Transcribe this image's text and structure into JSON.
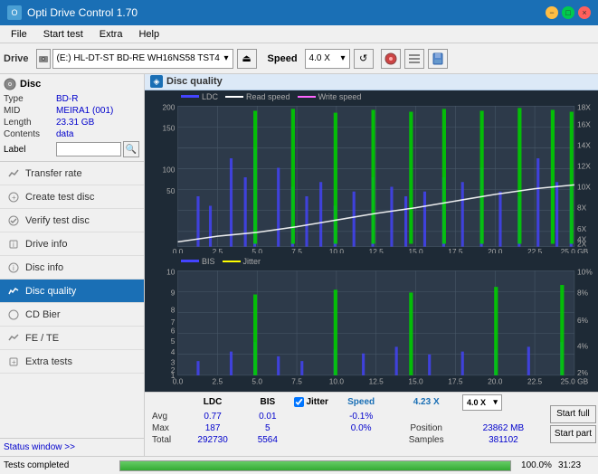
{
  "app": {
    "title": "Opti Drive Control 1.70",
    "icon": "O"
  },
  "titlebar": {
    "minimize": "−",
    "maximize": "□",
    "close": "×"
  },
  "menubar": {
    "items": [
      "File",
      "Start test",
      "Extra",
      "Help"
    ]
  },
  "toolbar": {
    "drive_label": "Drive",
    "drive_value": "(E:)  HL-DT-ST BD-RE  WH16NS58 TST4",
    "speed_label": "Speed",
    "speed_value": "4.0 X"
  },
  "disc": {
    "header": "Disc",
    "type_label": "Type",
    "type_value": "BD-R",
    "mid_label": "MID",
    "mid_value": "MEIRA1 (001)",
    "length_label": "Length",
    "length_value": "23.31 GB",
    "contents_label": "Contents",
    "contents_value": "data",
    "label_label": "Label",
    "label_value": ""
  },
  "sidebar": {
    "items": [
      {
        "id": "transfer-rate",
        "label": "Transfer rate",
        "active": false
      },
      {
        "id": "create-test-disc",
        "label": "Create test disc",
        "active": false
      },
      {
        "id": "verify-test-disc",
        "label": "Verify test disc",
        "active": false
      },
      {
        "id": "drive-info",
        "label": "Drive info",
        "active": false
      },
      {
        "id": "disc-info",
        "label": "Disc info",
        "active": false
      },
      {
        "id": "disc-quality",
        "label": "Disc quality",
        "active": true
      },
      {
        "id": "cd-bier",
        "label": "CD Bier",
        "active": false
      },
      {
        "id": "fe-te",
        "label": "FE / TE",
        "active": false
      },
      {
        "id": "extra-tests",
        "label": "Extra tests",
        "active": false
      }
    ]
  },
  "status_window": {
    "label": "Status window >>"
  },
  "panel": {
    "title": "Disc quality"
  },
  "chart_top": {
    "legend": [
      {
        "id": "ldc",
        "label": "LDC",
        "color": "#4444ff"
      },
      {
        "id": "read-speed",
        "label": "Read speed",
        "color": "#ffffff"
      },
      {
        "id": "write-speed",
        "label": "Write speed",
        "color": "#ff66ff"
      }
    ],
    "y_max": 200,
    "y_right_labels": [
      "18X",
      "16X",
      "14X",
      "12X",
      "10X",
      "8X",
      "6X",
      "4X",
      "2X"
    ],
    "x_labels": [
      "0.0",
      "2.5",
      "5.0",
      "7.5",
      "10.0",
      "12.5",
      "15.0",
      "17.5",
      "20.0",
      "22.5",
      "25.0 GB"
    ]
  },
  "chart_bottom": {
    "legend": [
      {
        "id": "bis",
        "label": "BIS",
        "color": "#4444ff"
      },
      {
        "id": "jitter",
        "label": "Jitter",
        "color": "#ffff00"
      }
    ],
    "y_max": 10,
    "y_right_labels": [
      "10%",
      "8%",
      "6%",
      "4%",
      "2%"
    ],
    "x_labels": [
      "0.0",
      "2.5",
      "5.0",
      "7.5",
      "10.0",
      "12.5",
      "15.0",
      "17.5",
      "20.0",
      "22.5",
      "25.0 GB"
    ]
  },
  "stats": {
    "columns": [
      "",
      "LDC",
      "BIS",
      "",
      "Jitter",
      "Speed",
      ""
    ],
    "rows": [
      {
        "label": "Avg",
        "ldc": "0.77",
        "bis": "0.01",
        "jitter": "-0.1%",
        "speed": "4.23 X"
      },
      {
        "label": "Max",
        "ldc": "187",
        "bis": "5",
        "jitter": "0.0%",
        "speed_label": "Position",
        "speed_val": "23862 MB"
      },
      {
        "label": "Total",
        "ldc": "292730",
        "bis": "5564",
        "jitter": "",
        "speed_label": "Samples",
        "speed_val": "381102"
      }
    ],
    "speed_current": "4.23 X",
    "speed_select": "4.0 X",
    "position_label": "Position",
    "position_value": "23862 MB",
    "samples_label": "Samples",
    "samples_value": "381102",
    "jitter_checked": true
  },
  "action_buttons": {
    "start_full": "Start full",
    "start_part": "Start part"
  },
  "bottom_bar": {
    "status": "Tests completed",
    "progress": 100,
    "progress_pct": "100.0%",
    "time": "31:23"
  }
}
